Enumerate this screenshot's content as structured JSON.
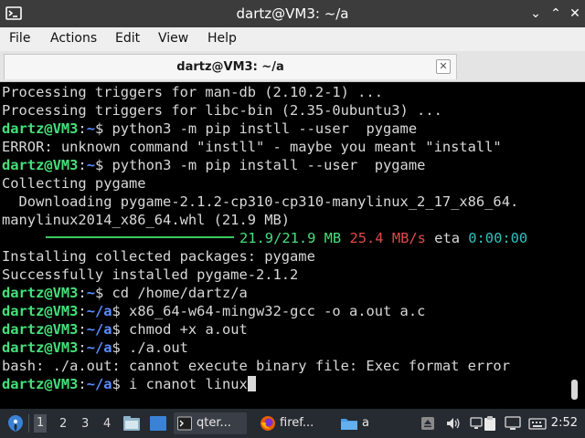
{
  "window": {
    "title": "dartz@VM3: ~/a",
    "minimize_glyph": "⌄",
    "maximize_glyph": "⌃",
    "close_glyph": "✕"
  },
  "menu": [
    "File",
    "Actions",
    "Edit",
    "View",
    "Help"
  ],
  "tab": {
    "label": "dartz@VM3: ~/a",
    "close_glyph": "✕"
  },
  "terminal": {
    "user": "dartz@VM3",
    "lines": [
      {
        "text": "Processing triggers for man-db (2.10.2-1) ..."
      },
      {
        "text": "Processing triggers for libc-bin (2.35-0ubuntu3) ..."
      },
      {
        "path": "~",
        "cmd": "python3 -m pip instll --user  pygame"
      },
      {
        "text": "ERROR: unknown command \"instll\" - maybe you meant \"install\""
      },
      {
        "path": "~",
        "cmd": "python3 -m pip install --user  pygame"
      },
      {
        "text": "Collecting pygame"
      },
      {
        "text": "  Downloading pygame-2.1.2-cp310-cp310-manylinux_2_17_x86_64."
      },
      {
        "text": "manylinux2014_x86_64.whl (21.9 MB)"
      },
      {
        "progress": {
          "size": "21.9/21.9 MB",
          "speed": "25.4 MB/s",
          "eta_label": "eta",
          "eta": "0:00:00",
          "fraction": 1.0
        }
      },
      {
        "text": "Installing collected packages: pygame"
      },
      {
        "text": "Successfully installed pygame-2.1.2"
      },
      {
        "path": "~",
        "cmd": "cd /home/dartz/a"
      },
      {
        "path": "~/a",
        "cmd": "x86_64-w64-mingw32-gcc -o a.out a.c"
      },
      {
        "path": "~/a",
        "cmd": "chmod +x a.out"
      },
      {
        "path": "~/a",
        "cmd": "./a.out"
      },
      {
        "text": "bash: ./a.out: cannot execute binary file: Exec format error"
      },
      {
        "path": "~/a",
        "cmd": "i cnanot linux",
        "cursor": true
      }
    ]
  },
  "taskbar": {
    "workspaces": [
      "1",
      "2",
      "3",
      "4"
    ],
    "active_workspace": "1",
    "tasks": [
      {
        "name": "qterminal",
        "label": "qter...",
        "icon": "terminal-icon"
      },
      {
        "name": "firefox",
        "label": "firef...",
        "icon": "firefox-icon"
      },
      {
        "name": "files",
        "label": "a",
        "icon": "folder-icon"
      }
    ],
    "clock": "2:52"
  },
  "colors": {
    "prompt_user": "#44e07a",
    "prompt_path": "#5a8cff",
    "progress_size": "#44e07a",
    "progress_speed": "#e04a4a",
    "progress_eta": "#30c0c0"
  }
}
